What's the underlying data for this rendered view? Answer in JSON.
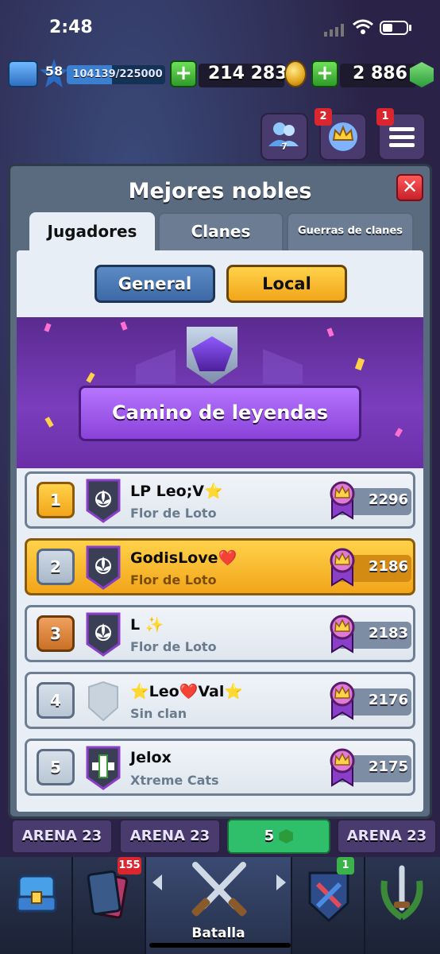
{
  "status_bar": {
    "time": "2:48"
  },
  "top_bar": {
    "level": "58",
    "xp": "104139/225000",
    "xp_progress": 0.4628,
    "gold": "214 283",
    "gems": "2 886"
  },
  "top_icons": {
    "friends_count": "7",
    "clan_badge_count": "2",
    "menu_badge_count": "1"
  },
  "modal": {
    "title": "Mejores nobles",
    "tabs": [
      {
        "label": "Jugadores",
        "active": true
      },
      {
        "label": "Clanes",
        "active": false
      },
      {
        "label": "Guerras de clanes",
        "active": false
      }
    ],
    "segment": {
      "general": "General",
      "local": "Local",
      "selected": "Local"
    },
    "banner_title": "Camino de leyendas",
    "players": [
      {
        "rank": "1",
        "name": "LP Leo;V⭐",
        "clan": "Flor de Loto",
        "score": "2296",
        "highlight": false,
        "rank_style": "gold"
      },
      {
        "rank": "2",
        "name": "GodisLove❤️",
        "clan": "Flor de Loto",
        "score": "2186",
        "highlight": true,
        "rank_style": "silver"
      },
      {
        "rank": "3",
        "name": "L ✨",
        "clan": "Flor de Loto",
        "score": "2183",
        "highlight": false,
        "rank_style": "bronze"
      },
      {
        "rank": "4",
        "name": "⭐Leo❤️Val⭐",
        "clan": "Sin clan",
        "score": "2176",
        "highlight": false,
        "rank_style": "plain"
      },
      {
        "rank": "5",
        "name": "Jelox",
        "clan": "Xtreme Cats",
        "score": "2175",
        "highlight": false,
        "rank_style": "plain"
      }
    ]
  },
  "arena_strip": {
    "left": "ARENA 23",
    "center_left": "ARENA 23",
    "center_value": "5",
    "right": "ARENA 23"
  },
  "bottom_nav": {
    "cards_badge": "155",
    "battle_label": "Batalla",
    "clan_badge": "1"
  },
  "colors": {
    "accent_gold": "#f2a51a",
    "accent_blue": "#3d6aa6",
    "accent_purple": "#7a3dbd",
    "close_red": "#c7202a"
  }
}
